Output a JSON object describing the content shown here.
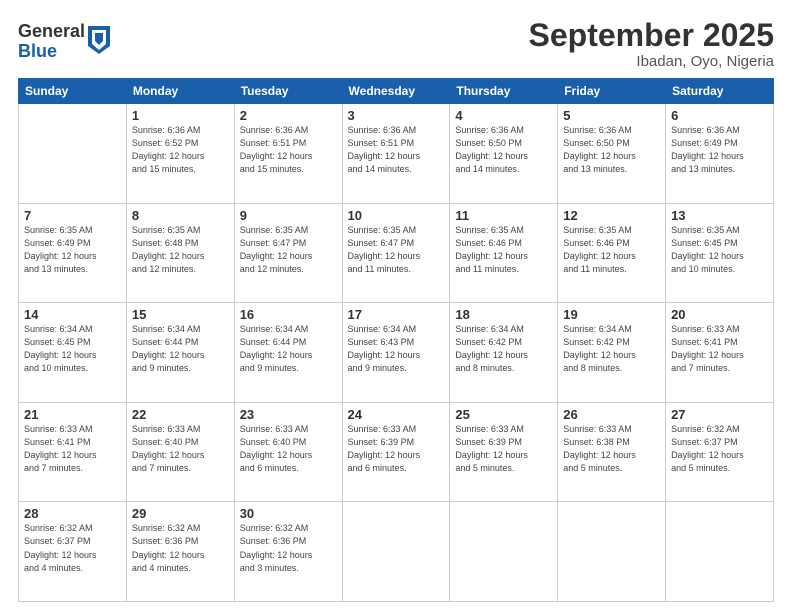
{
  "logo": {
    "general": "General",
    "blue": "Blue"
  },
  "header": {
    "title": "September 2025",
    "location": "Ibadan, Oyo, Nigeria"
  },
  "weekdays": [
    "Sunday",
    "Monday",
    "Tuesday",
    "Wednesday",
    "Thursday",
    "Friday",
    "Saturday"
  ],
  "weeks": [
    [
      {
        "day": "",
        "info": ""
      },
      {
        "day": "1",
        "info": "Sunrise: 6:36 AM\nSunset: 6:52 PM\nDaylight: 12 hours\nand 15 minutes."
      },
      {
        "day": "2",
        "info": "Sunrise: 6:36 AM\nSunset: 6:51 PM\nDaylight: 12 hours\nand 15 minutes."
      },
      {
        "day": "3",
        "info": "Sunrise: 6:36 AM\nSunset: 6:51 PM\nDaylight: 12 hours\nand 14 minutes."
      },
      {
        "day": "4",
        "info": "Sunrise: 6:36 AM\nSunset: 6:50 PM\nDaylight: 12 hours\nand 14 minutes."
      },
      {
        "day": "5",
        "info": "Sunrise: 6:36 AM\nSunset: 6:50 PM\nDaylight: 12 hours\nand 13 minutes."
      },
      {
        "day": "6",
        "info": "Sunrise: 6:36 AM\nSunset: 6:49 PM\nDaylight: 12 hours\nand 13 minutes."
      }
    ],
    [
      {
        "day": "7",
        "info": "Sunrise: 6:35 AM\nSunset: 6:49 PM\nDaylight: 12 hours\nand 13 minutes."
      },
      {
        "day": "8",
        "info": "Sunrise: 6:35 AM\nSunset: 6:48 PM\nDaylight: 12 hours\nand 12 minutes."
      },
      {
        "day": "9",
        "info": "Sunrise: 6:35 AM\nSunset: 6:47 PM\nDaylight: 12 hours\nand 12 minutes."
      },
      {
        "day": "10",
        "info": "Sunrise: 6:35 AM\nSunset: 6:47 PM\nDaylight: 12 hours\nand 11 minutes."
      },
      {
        "day": "11",
        "info": "Sunrise: 6:35 AM\nSunset: 6:46 PM\nDaylight: 12 hours\nand 11 minutes."
      },
      {
        "day": "12",
        "info": "Sunrise: 6:35 AM\nSunset: 6:46 PM\nDaylight: 12 hours\nand 11 minutes."
      },
      {
        "day": "13",
        "info": "Sunrise: 6:35 AM\nSunset: 6:45 PM\nDaylight: 12 hours\nand 10 minutes."
      }
    ],
    [
      {
        "day": "14",
        "info": "Sunrise: 6:34 AM\nSunset: 6:45 PM\nDaylight: 12 hours\nand 10 minutes."
      },
      {
        "day": "15",
        "info": "Sunrise: 6:34 AM\nSunset: 6:44 PM\nDaylight: 12 hours\nand 9 minutes."
      },
      {
        "day": "16",
        "info": "Sunrise: 6:34 AM\nSunset: 6:44 PM\nDaylight: 12 hours\nand 9 minutes."
      },
      {
        "day": "17",
        "info": "Sunrise: 6:34 AM\nSunset: 6:43 PM\nDaylight: 12 hours\nand 9 minutes."
      },
      {
        "day": "18",
        "info": "Sunrise: 6:34 AM\nSunset: 6:42 PM\nDaylight: 12 hours\nand 8 minutes."
      },
      {
        "day": "19",
        "info": "Sunrise: 6:34 AM\nSunset: 6:42 PM\nDaylight: 12 hours\nand 8 minutes."
      },
      {
        "day": "20",
        "info": "Sunrise: 6:33 AM\nSunset: 6:41 PM\nDaylight: 12 hours\nand 7 minutes."
      }
    ],
    [
      {
        "day": "21",
        "info": "Sunrise: 6:33 AM\nSunset: 6:41 PM\nDaylight: 12 hours\nand 7 minutes."
      },
      {
        "day": "22",
        "info": "Sunrise: 6:33 AM\nSunset: 6:40 PM\nDaylight: 12 hours\nand 7 minutes."
      },
      {
        "day": "23",
        "info": "Sunrise: 6:33 AM\nSunset: 6:40 PM\nDaylight: 12 hours\nand 6 minutes."
      },
      {
        "day": "24",
        "info": "Sunrise: 6:33 AM\nSunset: 6:39 PM\nDaylight: 12 hours\nand 6 minutes."
      },
      {
        "day": "25",
        "info": "Sunrise: 6:33 AM\nSunset: 6:39 PM\nDaylight: 12 hours\nand 5 minutes."
      },
      {
        "day": "26",
        "info": "Sunrise: 6:33 AM\nSunset: 6:38 PM\nDaylight: 12 hours\nand 5 minutes."
      },
      {
        "day": "27",
        "info": "Sunrise: 6:32 AM\nSunset: 6:37 PM\nDaylight: 12 hours\nand 5 minutes."
      }
    ],
    [
      {
        "day": "28",
        "info": "Sunrise: 6:32 AM\nSunset: 6:37 PM\nDaylight: 12 hours\nand 4 minutes."
      },
      {
        "day": "29",
        "info": "Sunrise: 6:32 AM\nSunset: 6:36 PM\nDaylight: 12 hours\nand 4 minutes."
      },
      {
        "day": "30",
        "info": "Sunrise: 6:32 AM\nSunset: 6:36 PM\nDaylight: 12 hours\nand 3 minutes."
      },
      {
        "day": "",
        "info": ""
      },
      {
        "day": "",
        "info": ""
      },
      {
        "day": "",
        "info": ""
      },
      {
        "day": "",
        "info": ""
      }
    ]
  ]
}
